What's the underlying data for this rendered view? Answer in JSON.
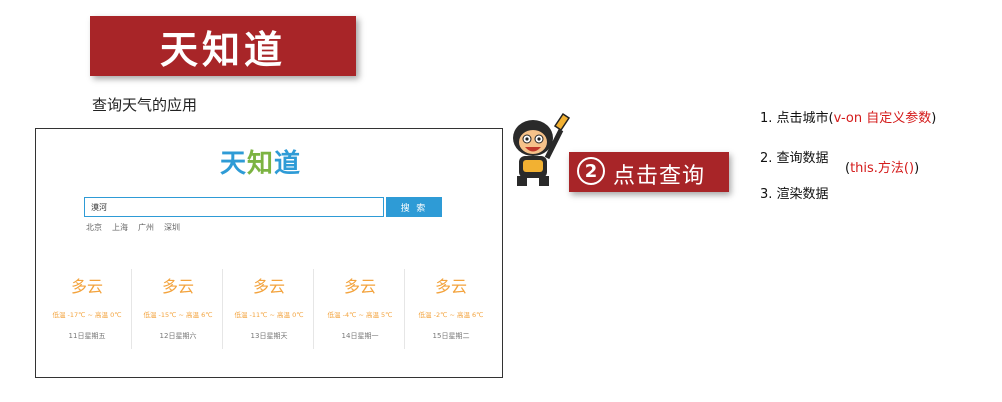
{
  "banner": {
    "title": "天知道"
  },
  "subtitle": "查询天气的应用",
  "app": {
    "logo": [
      "天",
      "知",
      "道"
    ],
    "search": {
      "value": "漠河",
      "button": "搜 索"
    },
    "hot_cities": [
      "北京",
      "上海",
      "广州",
      "深圳"
    ],
    "forecast": [
      {
        "weather": "多云",
        "temp": "低温 -17℃ ~ 高温 0℃",
        "date": "11日星期五"
      },
      {
        "weather": "多云",
        "temp": "低温 -15℃ ~ 高温 6℃",
        "date": "12日星期六"
      },
      {
        "weather": "多云",
        "temp": "低温 -11℃ ~ 高温 0℃",
        "date": "13日星期天"
      },
      {
        "weather": "多云",
        "temp": "低温 -4℃ ~ 高温 5℃",
        "date": "14日星期一"
      },
      {
        "weather": "多云",
        "temp": "低温 -2℃ ~ 高温 6℃",
        "date": "15日星期二"
      }
    ]
  },
  "step": {
    "number": "2",
    "label": "点击查询"
  },
  "notes": {
    "n1_prefix": "1. 点击城市(",
    "n1_red": "v-on 自定义参数",
    "n1_suffix": ")",
    "n2": "2. 查询数据",
    "n2_paren_open": "(",
    "n2_red": "this.方法()",
    "n2_paren_close": ")",
    "n3": "3. 渲染数据"
  },
  "colors": {
    "brand_red": "#a82528",
    "accent_blue": "#2e9bd6",
    "weather_orange": "#f3a33d",
    "note_red": "#d41a1a"
  }
}
